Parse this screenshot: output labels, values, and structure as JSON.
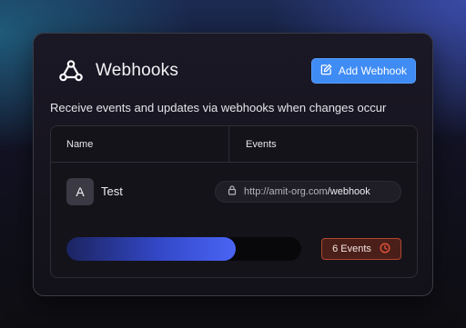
{
  "header": {
    "title": "Webhooks",
    "add_button_label": "Add Webhook"
  },
  "subtitle": "Receive events and updates via webhooks when changes occur",
  "table": {
    "columns": [
      "Name",
      "Events"
    ],
    "row": {
      "avatar_letter": "A",
      "name": "Test",
      "url_host": "http://amit-org.com",
      "url_path": "/webhook",
      "events_label": "6 Events",
      "progress_fraction": 0.72
    }
  },
  "colors": {
    "accent_button": "#3f8cf5",
    "events_badge_border": "#b3462f",
    "events_badge_bg": "#4a1f1a",
    "progress_fill": "#4a64f4"
  },
  "icons": {
    "logo": "webhook-icon",
    "add_button": "edit-icon",
    "url": "lock-icon",
    "events": "clock-icon"
  }
}
